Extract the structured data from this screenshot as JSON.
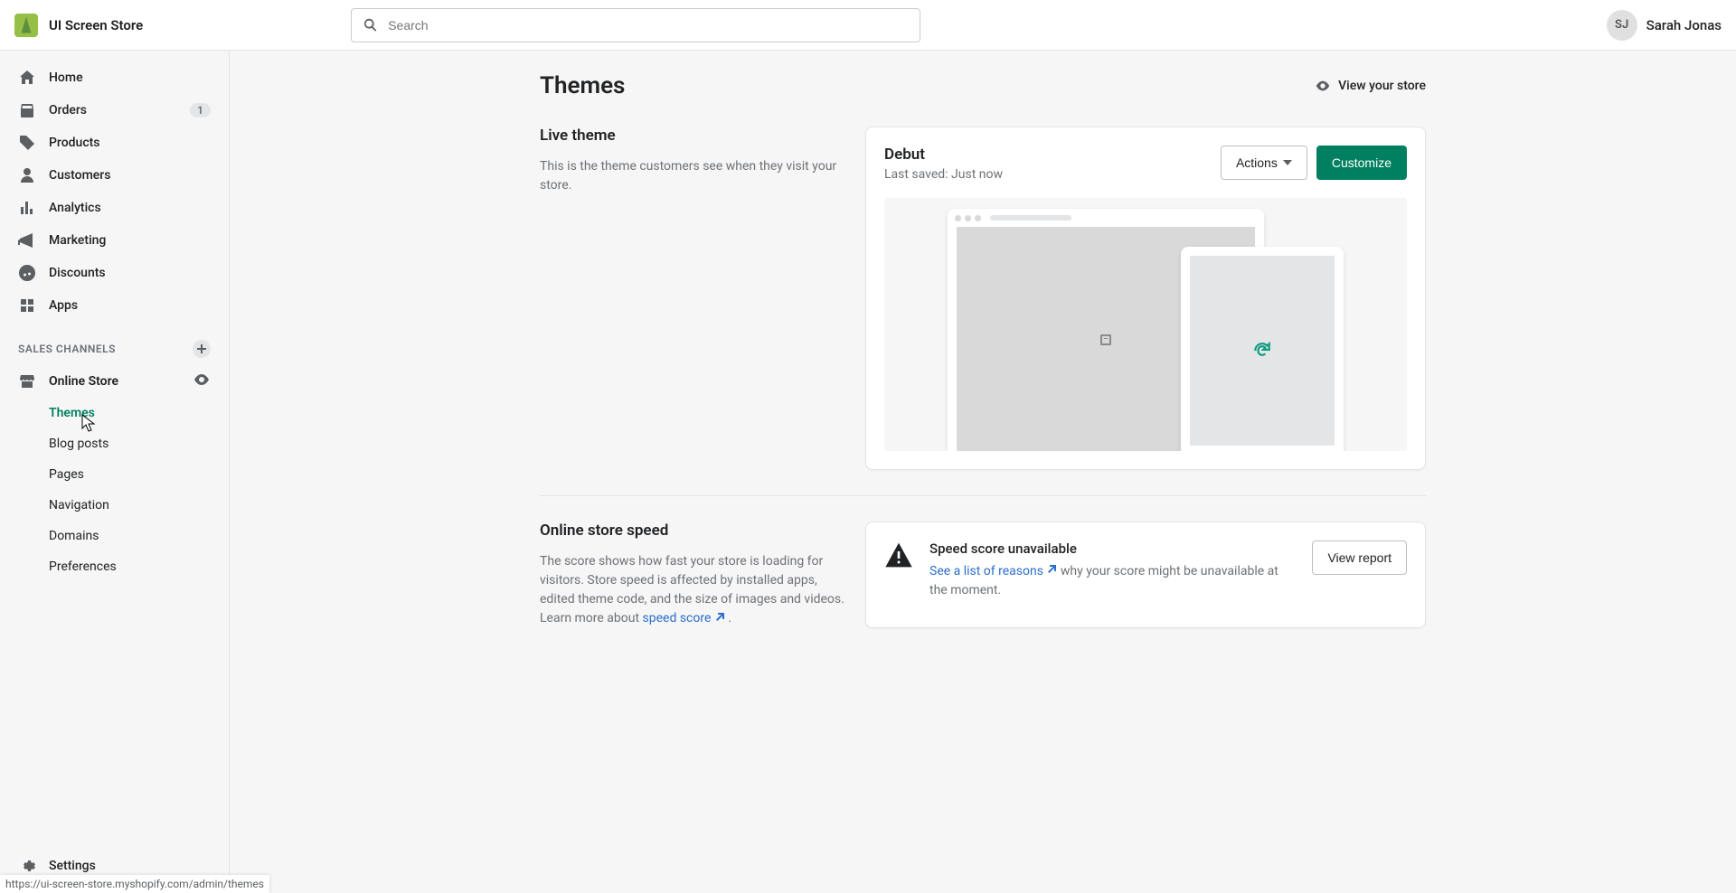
{
  "header": {
    "brand": "UI Screen Store",
    "search_placeholder": "Search",
    "user_initials": "SJ",
    "user_name": "Sarah Jonas"
  },
  "sidebar": {
    "primary": [
      {
        "label": "Home",
        "icon": "home"
      },
      {
        "label": "Orders",
        "icon": "orders",
        "badge": "1"
      },
      {
        "label": "Products",
        "icon": "products"
      },
      {
        "label": "Customers",
        "icon": "customers"
      },
      {
        "label": "Analytics",
        "icon": "analytics"
      },
      {
        "label": "Marketing",
        "icon": "marketing"
      },
      {
        "label": "Discounts",
        "icon": "discounts"
      },
      {
        "label": "Apps",
        "icon": "apps"
      }
    ],
    "section_label": "SALES CHANNELS",
    "channel": {
      "label": "Online Store"
    },
    "sub": [
      {
        "label": "Themes",
        "active": true
      },
      {
        "label": "Blog posts"
      },
      {
        "label": "Pages"
      },
      {
        "label": "Navigation"
      },
      {
        "label": "Domains"
      },
      {
        "label": "Preferences"
      }
    ],
    "settings": "Settings"
  },
  "page": {
    "title": "Themes",
    "view_store": "View your store"
  },
  "live": {
    "heading": "Live theme",
    "desc": "This is the theme customers see when they visit your store.",
    "theme_name": "Debut",
    "saved": "Last saved: Just now",
    "actions_btn": "Actions",
    "customize_btn": "Customize"
  },
  "speed": {
    "heading": "Online store speed",
    "desc_pre": "The score shows how fast your store is loading for visitors. Store speed is affected by installed apps, edited theme code, and the size of images and videos. Learn more about ",
    "link": "speed score",
    "desc_post": " .",
    "banner_title": "Speed score unavailable",
    "banner_link": "See a list of reasons",
    "banner_post": " why your score might be unavailable at the moment.",
    "view_report": "View report"
  },
  "status_url": "https://ui-screen-store.myshopify.com/admin/themes"
}
